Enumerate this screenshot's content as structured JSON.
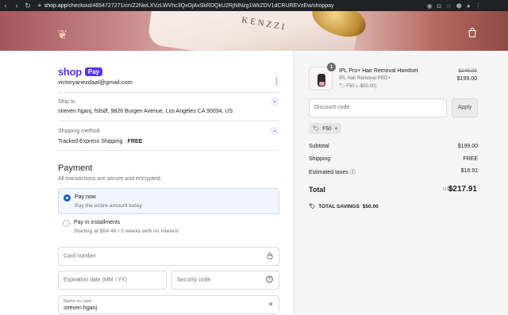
{
  "browser": {
    "url_host": "shop.app",
    "url_path": "/checkout/4654727271/cn/Z2NwLXVzLWVhc3QxOjAxSkRDQkU2RjNlNzg1WkZDV1dCRUREVzEw/shoppay",
    "back_icon": "arrow-left-icon",
    "forward_icon": "arrow-right-icon",
    "reload_icon": "reload-icon"
  },
  "hero": {
    "brand_text": "KENZZI",
    "bag_icon": "shopping-bag-icon"
  },
  "account": {
    "logo_shop": "shop",
    "logo_pay": "Pay",
    "email": "victoryanezdaal@gmail.com"
  },
  "ship_to": {
    "label": "Ship to",
    "value": "streven hganj, fsfsdf, 9826 Burgen Avenue, Los Angeles CA 90034, US"
  },
  "shipping_method": {
    "label": "Shipping method",
    "value": "Tracked Express Shipping · ",
    "price": "FREE"
  },
  "payment": {
    "title": "Payment",
    "subtitle": "All transactions are secure and encrypted.",
    "options": [
      {
        "title": "Pay now",
        "desc": "Pay the entire amount today",
        "selected": true
      },
      {
        "title": "Pay in installments",
        "desc": "Starting at $54.48 / 2 weeks with no interest",
        "selected": false
      }
    ],
    "card_number_placeholder": "Card number",
    "expiration_placeholder": "Expiration date (MM / YY)",
    "security_code_placeholder": "Security code",
    "name_on_card_label": "Name on card",
    "name_on_card_value": "streven hganj"
  },
  "order": {
    "qty": "1",
    "product_name": "IPL Pro+ Hair Removal Handset",
    "variant": "IPL Hair Removal PRO+",
    "discount_line": "F50 (−$50.00)",
    "old_price": "$249.00",
    "new_price": "$199.00",
    "discount_placeholder": "Discount code",
    "apply_label": "Apply",
    "applied_code": "F50",
    "subtotal_label": "Subtotal",
    "subtotal": "$199.00",
    "shipping_label": "Shipping",
    "shipping": "FREE",
    "taxes_label": "Estimated taxes",
    "taxes": "$18.91",
    "total_label": "Total",
    "currency": "USD",
    "total": "$217.91",
    "savings_label": "TOTAL SAVINGS",
    "savings": "$50.00"
  },
  "colors": {
    "shop_purple": "#5a31f4",
    "selected_radio": "#1a5fc4",
    "selected_bg": "#f0f5ff"
  }
}
